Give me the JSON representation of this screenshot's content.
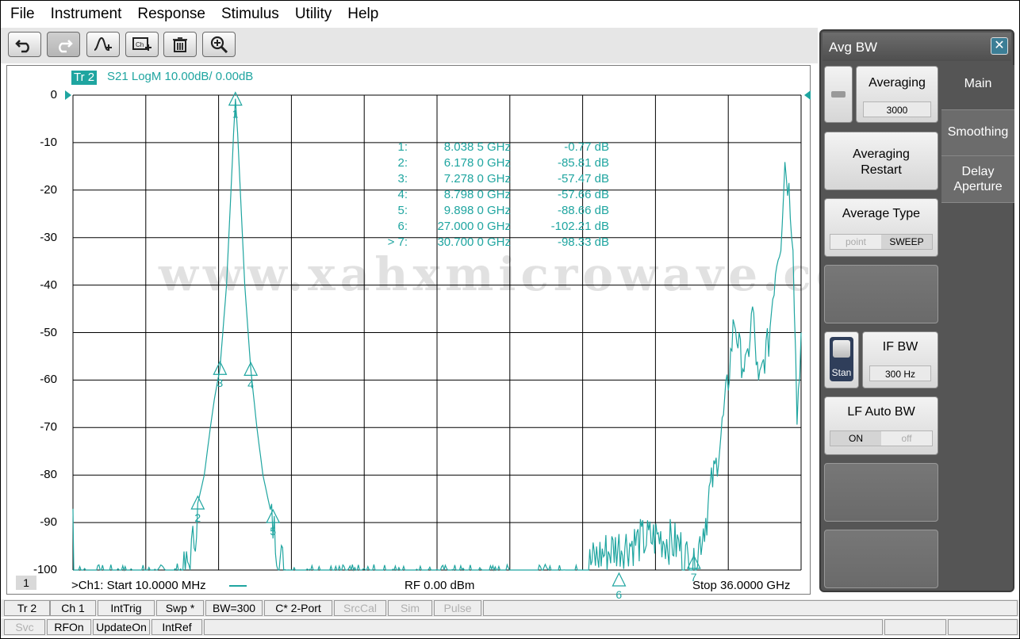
{
  "menu": [
    "File",
    "Instrument",
    "Response",
    "Stimulus",
    "Utility",
    "Help"
  ],
  "toolbar": {
    "buttons": [
      "undo-icon",
      "redo-icon",
      "add-trace-icon",
      "add-channel-icon",
      "delete-icon",
      "zoom-icon"
    ]
  },
  "trace": {
    "id": "Tr 2",
    "title": "S21 LogM 10.00dB/  0.00dB"
  },
  "markers": [
    {
      "num": "1:",
      "freq": "8.038 5 GHz",
      "val": "-0.77 dB"
    },
    {
      "num": "2:",
      "freq": "6.178 0 GHz",
      "val": "-85.81 dB"
    },
    {
      "num": "3:",
      "freq": "7.278 0 GHz",
      "val": "-57.47 dB"
    },
    {
      "num": "4:",
      "freq": "8.798 0 GHz",
      "val": "-57.66 dB"
    },
    {
      "num": "5:",
      "freq": "9.898 0 GHz",
      "val": "-88.66 dB"
    },
    {
      "num": "6:",
      "freq": "27.000 0 GHz",
      "val": "-102.21 dB"
    },
    {
      "num": "> 7:",
      "freq": "30.700 0 GHz",
      "val": "-98.33 dB"
    }
  ],
  "watermark": "www.xahxmicrowave.com",
  "channel_number": "1",
  "bottom": {
    "start": ">Ch1:  Start   10.0000 MHz",
    "rf": "RF    0.00 dBm",
    "stop": "Stop  36.0000 GHz"
  },
  "panel": {
    "title": "Avg BW",
    "close": "✕",
    "averaging_label": "Averaging",
    "averaging_value": "3000",
    "restart_label": "Averaging Restart",
    "avg_type_label": "Average Type",
    "avg_type_point": "point",
    "avg_type_sweep": "SWEEP",
    "stan_label": "Stan",
    "ifbw_label": "IF BW",
    "ifbw_value": "300 Hz",
    "lfauto_label": "LF Auto BW",
    "lfauto_on": "ON",
    "lfauto_off": "off",
    "tabs": [
      "Main",
      "Smoothing",
      "Delay Aperture"
    ]
  },
  "status1": [
    "Tr 2",
    "Ch 1",
    "IntTrig",
    "Swp *",
    "BW=300",
    "C* 2-Port",
    "SrcCal",
    "Sim",
    "Pulse"
  ],
  "status2": [
    "Svc",
    "RFOn",
    "UpdateOn",
    "IntRef"
  ],
  "chart_data": {
    "type": "line",
    "title": "S21 LogM 10.00dB/  0.00dB",
    "xlabel": "",
    "ylabel": "",
    "xlim": [
      0.01,
      36.0
    ],
    "ylim": [
      -100,
      0
    ],
    "y_ticks": [
      "0",
      "-10",
      "-20",
      "-30",
      "-40",
      "-50",
      "-60",
      "-70",
      "-80",
      "-90",
      "-100"
    ],
    "grid": true,
    "color": "#1fa5a0",
    "series": [
      {
        "x": [
          0.01,
          0.05,
          1.0,
          3.0,
          5.0,
          5.5,
          5.8,
          6.0,
          6.178,
          6.5,
          6.8,
          7.0,
          7.278,
          7.6,
          7.8,
          7.95,
          8.0385,
          8.15,
          8.3,
          8.5,
          8.798,
          9.1,
          9.4,
          9.7,
          9.898,
          10.2,
          10.6,
          11.0,
          14.0,
          18.0,
          22.0,
          24.0,
          25.0,
          25.5,
          26.0,
          27.0,
          28.0,
          29.0,
          30.0,
          30.7,
          31.0,
          31.4,
          31.8,
          32.1,
          32.4,
          32.7,
          33.0,
          33.3,
          33.6,
          33.9,
          34.2,
          34.4,
          34.6,
          34.8,
          35.0,
          35.2,
          35.4,
          35.6,
          35.8,
          36.0
        ],
        "y": [
          -85,
          -100,
          -100,
          -100,
          -100,
          -99,
          -96,
          -91,
          -86,
          -80,
          -70,
          -64,
          -57.47,
          -40,
          -22,
          -8,
          -0.77,
          -8,
          -22,
          -40,
          -57.66,
          -70,
          -80,
          -86,
          -88.66,
          -95,
          -99,
          -100,
          -100,
          -100,
          -100,
          -100,
          -100,
          -97,
          -95,
          -93,
          -92,
          -91,
          -93,
          -98.33,
          -92,
          -85,
          -78,
          -70,
          -60,
          -47,
          -55,
          -58,
          -45,
          -62,
          -55,
          -52,
          -42,
          -34,
          -30,
          -14,
          -20,
          -30,
          -68,
          -50
        ]
      }
    ],
    "marker_labels": [
      "1",
      "2",
      "3",
      "4",
      "5",
      "6",
      "7"
    ]
  }
}
